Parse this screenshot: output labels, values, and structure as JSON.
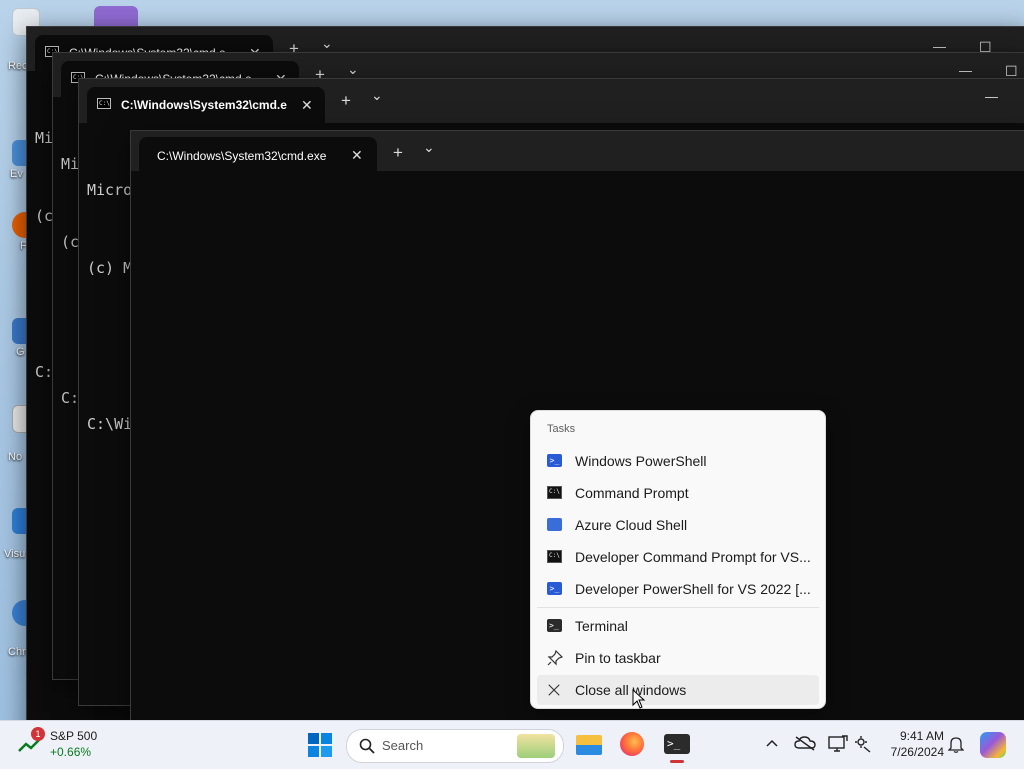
{
  "desktop": {
    "icons": [
      {
        "label": "Rec",
        "icon": "recycle-bin-icon"
      },
      {
        "label": "Ev",
        "icon": "shortcut-icon"
      },
      {
        "label": "F",
        "icon": "firefox-shortcut-icon"
      },
      {
        "label": "G",
        "icon": "shortcut-icon"
      },
      {
        "label": "No",
        "icon": "notepad-shortcut-icon"
      },
      {
        "label": "Visu",
        "icon": "visual-studio-shortcut-icon"
      },
      {
        "label": "Chrom",
        "icon": "chrome-shortcut-icon"
      }
    ]
  },
  "windows": [
    {
      "tab_title": "C:\\Windows\\System32\\cmd.e",
      "console_lines": [
        "Mi",
        "(c",
        "",
        "C:"
      ]
    },
    {
      "tab_title": "C:\\Windows\\System32\\cmd.e",
      "console_lines": [
        "Mi",
        "(c",
        "",
        "C:"
      ]
    },
    {
      "tab_title": "C:\\Windows\\System32\\cmd.e",
      "console_lines": [
        "Micro",
        "(c) M",
        "",
        "C:\\Wi"
      ]
    },
    {
      "tab_title": "C:\\Windows\\System32\\cmd.exe",
      "console_lines": []
    }
  ],
  "tabbar": {
    "new_tab": "+",
    "dropdown": "⌄",
    "close": "✕"
  },
  "window_controls": {
    "minimize": "—",
    "maximize": "☐"
  },
  "jump_list": {
    "header": "Tasks",
    "tasks": [
      {
        "label": "Windows PowerShell",
        "icon": "powershell-icon"
      },
      {
        "label": "Command Prompt",
        "icon": "command-prompt-icon"
      },
      {
        "label": "Azure Cloud Shell",
        "icon": "azure-cloud-shell-icon"
      },
      {
        "label": "Developer Command Prompt for VS...",
        "icon": "command-prompt-icon"
      },
      {
        "label": "Developer PowerShell for VS 2022 [...",
        "icon": "powershell-icon"
      }
    ],
    "actions": [
      {
        "label": "Terminal",
        "icon": "terminal-icon"
      },
      {
        "label": "Pin to taskbar",
        "icon": "pin-icon"
      },
      {
        "label": "Close all windows",
        "icon": "close-icon"
      }
    ]
  },
  "taskbar": {
    "widget": {
      "name": "S&P 500",
      "change": "+0.66%",
      "badge": "1"
    },
    "search_placeholder": "Search",
    "clock": {
      "time": "9:41 AM",
      "date": "7/26/2024"
    },
    "tray_icons": [
      "chevron-up-icon",
      "onedrive-icon",
      "display-icon",
      "settings-icon",
      "notification-bell-icon",
      "copilot-icon"
    ],
    "pinned_apps": [
      "start-icon",
      "file-explorer-icon",
      "firefox-icon",
      "terminal-icon"
    ]
  },
  "colors": {
    "accent": "#0067c0",
    "terminal_bg": "#0c0c0c",
    "titlebar_bg": "#202020",
    "stock_up": "#0a7a1e",
    "running_indicator": "#d13438"
  }
}
